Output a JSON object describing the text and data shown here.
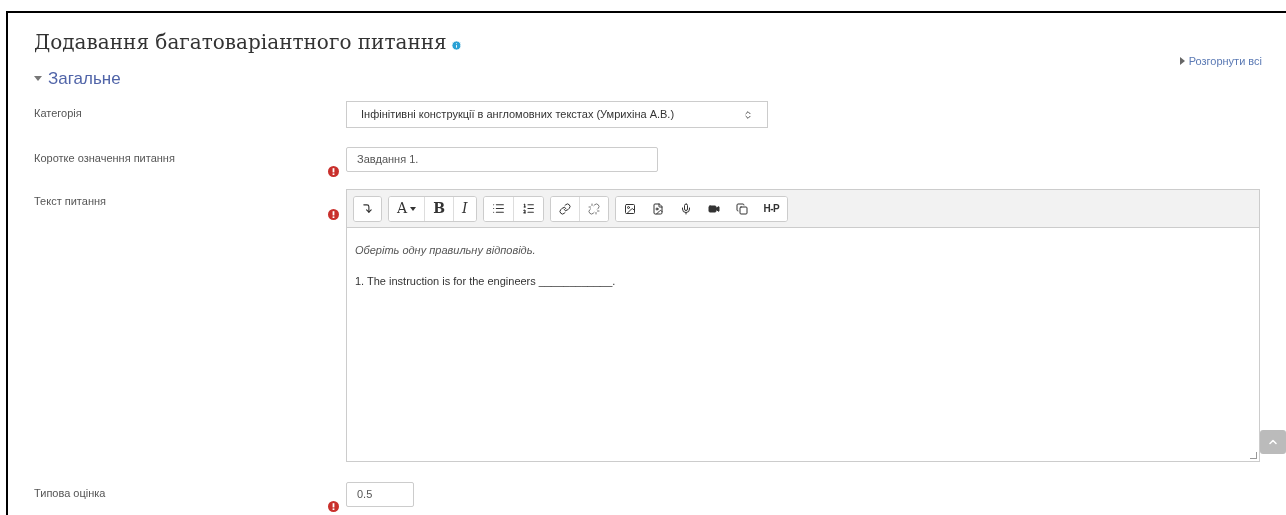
{
  "title": "Додавання багатоваріантного питання",
  "expand_all": "Розгорнути всі",
  "section": {
    "title": "Загальне",
    "expanded": true
  },
  "fields": [
    {
      "kind": "select",
      "label": "Категорія",
      "required": false,
      "value": "Інфінітивні конструкції в англомовних текстах (Умрихіна А.В.)"
    },
    {
      "kind": "text",
      "label": "Коротке означення питання",
      "required": true,
      "value": "Завдання 1."
    },
    {
      "kind": "editor",
      "label": "Текст питання",
      "required": true,
      "toolbar": {
        "font": "A",
        "bold": "B",
        "italic": "I",
        "h5p": "H-P"
      },
      "paragraphs": [
        {
          "text": "Оберіть одну правильну відповідь.",
          "italic": true
        },
        {
          "text": "1. The instruction is for the engineers ____________.",
          "italic": false
        }
      ]
    },
    {
      "kind": "short",
      "label": "Типова оцінка",
      "required": true,
      "value": "0.5"
    }
  ]
}
